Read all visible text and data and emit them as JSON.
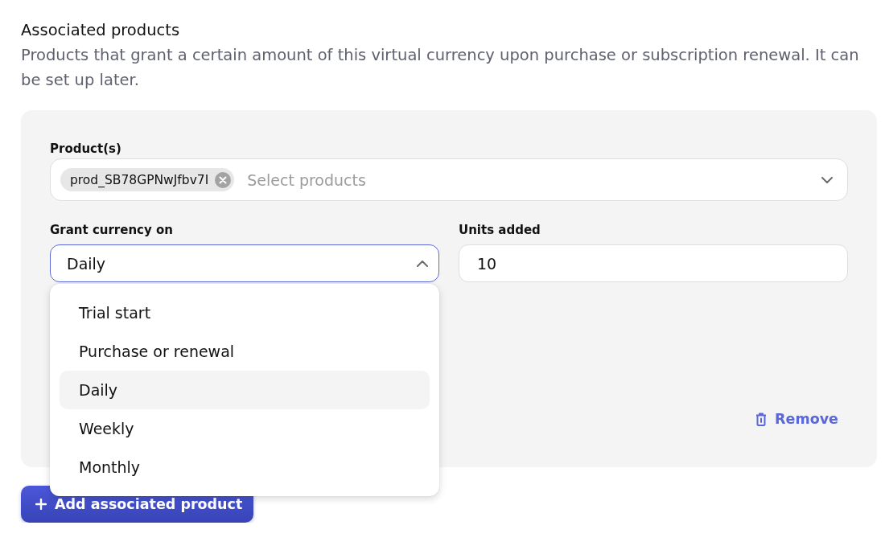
{
  "section": {
    "title": "Associated products",
    "description": "Products that grant a certain amount of this virtual currency upon purchase or subscription renewal. It can be set up later."
  },
  "product_card": {
    "products_field": {
      "label": "Product(s)",
      "chips": [
        "prod_SB78GPNwJfbv7I"
      ],
      "placeholder": "Select products"
    },
    "grant_select": {
      "label": "Grant currency on",
      "value": "Daily",
      "expanded": true,
      "options": [
        {
          "label": "Trial start",
          "selected": false
        },
        {
          "label": "Purchase or renewal",
          "selected": false
        },
        {
          "label": "Daily",
          "selected": true
        },
        {
          "label": "Weekly",
          "selected": false
        },
        {
          "label": "Monthly",
          "selected": false
        }
      ]
    },
    "units_field": {
      "label": "Units added",
      "value": "10"
    },
    "remove_button": {
      "label": "Remove"
    }
  },
  "add_button": {
    "label": "Add associated product"
  }
}
